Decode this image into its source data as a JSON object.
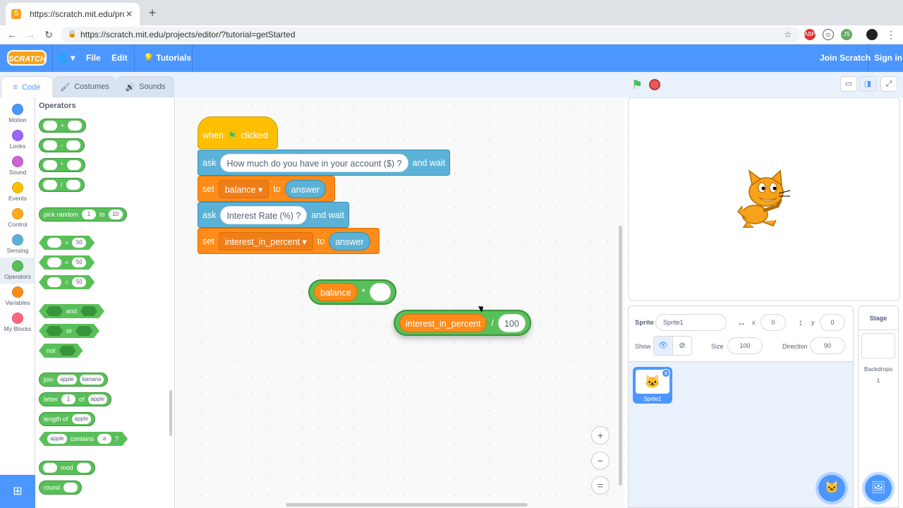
{
  "browser": {
    "tab_title": "https://scratch.mit.edu/project",
    "url": "https://scratch.mit.edu/projects/editor/?tutorial=getStarted",
    "ext1": "ABP",
    "ext2": "JS"
  },
  "menubar": {
    "logo": "SCRATCH",
    "file": "File",
    "edit": "Edit",
    "tutorials": "Tutorials",
    "join": "Join Scratch",
    "signin": "Sign in"
  },
  "editor_tabs": {
    "code": "Code",
    "costumes": "Costumes",
    "sounds": "Sounds"
  },
  "categories": [
    {
      "label": "Motion",
      "color": "#4c97ff"
    },
    {
      "label": "Looks",
      "color": "#9966ff"
    },
    {
      "label": "Sound",
      "color": "#cf63cf"
    },
    {
      "label": "Events",
      "color": "#ffbf00"
    },
    {
      "label": "Control",
      "color": "#ffab19"
    },
    {
      "label": "Sensing",
      "color": "#5cb1d6"
    },
    {
      "label": "Operators",
      "color": "#59c059"
    },
    {
      "label": "Variables",
      "color": "#ff8c1a"
    },
    {
      "label": "My Blocks",
      "color": "#ff6680"
    }
  ],
  "palette": {
    "title": "Operators",
    "plus": "+",
    "minus": "-",
    "times": "*",
    "divide": "/",
    "pick_random": "pick random",
    "pr_from": "1",
    "pr_to_label": "to",
    "pr_to": "10",
    "gt": ">",
    "lt": "<",
    "eq": "=",
    "cmp_val": "50",
    "and": "and",
    "or": "or",
    "not": "not",
    "join": "join",
    "join_a": "apple",
    "join_b": "banana",
    "letter": "letter",
    "letter_n": "1",
    "letter_of": "of",
    "letter_w": "apple",
    "length_of": "length of",
    "length_w": "apple",
    "contains_w": "apple",
    "contains": "contains",
    "contains_l": "a",
    "q": "?",
    "mod": "mod",
    "round": "round"
  },
  "script": {
    "when": "when",
    "clicked": "clicked",
    "ask1": "ask",
    "ask1_text": "How much do you have in your account ($) ?",
    "and_wait": "and wait",
    "set1": "set",
    "set1_var": "balance ▾",
    "to": "to",
    "answer": "answer",
    "ask2": "ask",
    "ask2_text": "Interest Rate (%) ?",
    "set2": "set",
    "set2_var": "interest_in_percent ▾"
  },
  "loose": {
    "mul_var": "balance",
    "mul_op": "*",
    "div_var": "interest_in_percent",
    "div_op": "/",
    "div_val": "100"
  },
  "zoom": {
    "in": "+",
    "out": "−",
    "reset": "="
  },
  "sprite_info": {
    "sprite_label": "Sprite",
    "sprite_name": "Sprite1",
    "x_label": "x",
    "x_val": "0",
    "y_label": "y",
    "y_val": "0",
    "show_label": "Show",
    "size_label": "Size",
    "size_val": "100",
    "direction_label": "Direction",
    "direction_val": "90"
  },
  "sprites": [
    {
      "name": "Sprite1"
    }
  ],
  "stage_pane": {
    "title": "Stage",
    "backdrops_label": "Backdrops",
    "backdrops_count": "1"
  }
}
